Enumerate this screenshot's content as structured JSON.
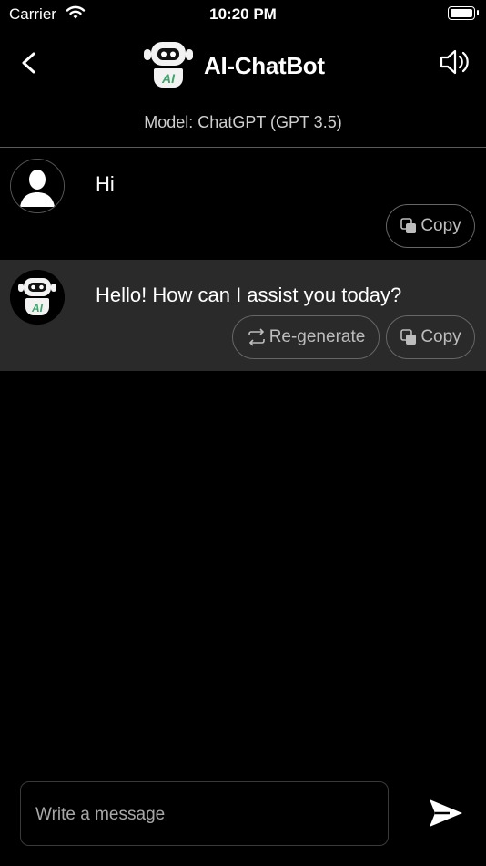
{
  "status_bar": {
    "carrier": "Carrier",
    "time": "10:20 PM"
  },
  "nav": {
    "title": "AI-ChatBot",
    "logo_text": "AI"
  },
  "model_label": "Model: ChatGPT (GPT 3.5)",
  "messages": [
    {
      "role": "user",
      "text": "Hi",
      "copy_label": "Copy"
    },
    {
      "role": "bot",
      "text": "Hello! How can I assist you today?",
      "regenerate_label": "Re-generate",
      "copy_label": "Copy",
      "logo_text": "AI"
    }
  ],
  "composer": {
    "placeholder": "Write a message"
  },
  "colors": {
    "background": "#000000",
    "bot_row": "#2a2a2a",
    "logo_green": "#3fa56b"
  }
}
